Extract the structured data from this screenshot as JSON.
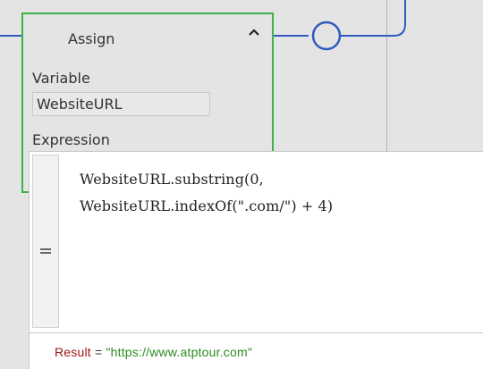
{
  "assign": {
    "title": "Assign",
    "collapse_icon": "chevron-up-icon",
    "variable_label": "Variable",
    "variable_value": "WebsiteURL",
    "expression_label": "Expression",
    "expression_lines": [
      "WebsiteURL.substring(0,",
      "WebsiteURL.indexOf(\".com/\") + 4)"
    ],
    "grip_icon": "grip-lines-icon"
  },
  "result": {
    "label": "Result",
    "equals": " = ",
    "value": "\"https://www.atptour.com\""
  },
  "colors": {
    "canvas": "#e4e4e4",
    "selected_border": "#3bb34a",
    "connector": "#2f5bbd",
    "result_label": "#a31515",
    "result_value": "#2c8c20"
  }
}
